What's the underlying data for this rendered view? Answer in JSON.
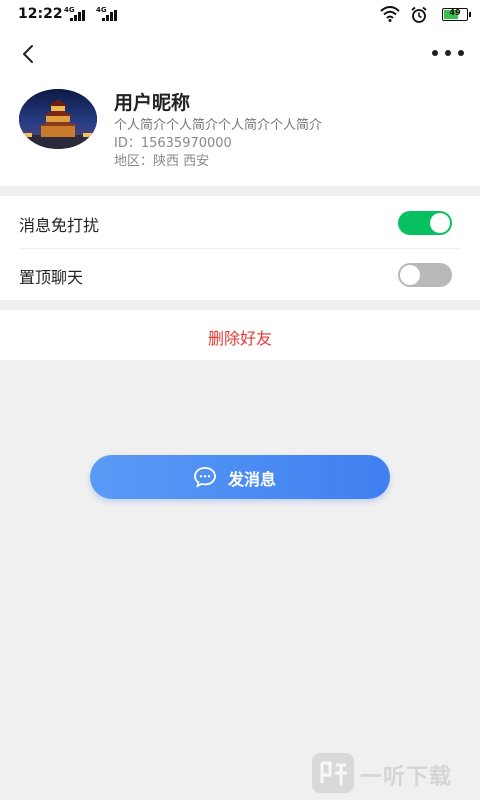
{
  "status_bar": {
    "time": "12:22",
    "network_1": "4G",
    "network_2": "4G",
    "battery": "49",
    "icons": [
      "signal-icon",
      "signal-icon",
      "wifi-icon",
      "alarm-icon",
      "battery-icon"
    ]
  },
  "nav": {
    "back_icon": "chevron-left-icon",
    "more_icon": "more-icon"
  },
  "profile": {
    "nickname": "用户昵称",
    "intro": "个人简介个人简介个人简介个人简介",
    "id_text": "ID：15635970000",
    "region_text": "地区：陕西  西安"
  },
  "settings": [
    {
      "label": "消息免打扰",
      "enabled": true
    },
    {
      "label": "置顶聊天",
      "enabled": false
    }
  ],
  "delete_friend": {
    "label": "删除好友",
    "color": "#e53935"
  },
  "send_message": {
    "label": "发消息",
    "icon": "chat-bubble-icon"
  },
  "watermark": {
    "text": "一听下载"
  },
  "colors": {
    "toggle_on": "#07c160",
    "toggle_off": "#b9b9b9",
    "primary_button": "#4a8cf3",
    "danger": "#e53935",
    "background": "#f0f0f0"
  }
}
